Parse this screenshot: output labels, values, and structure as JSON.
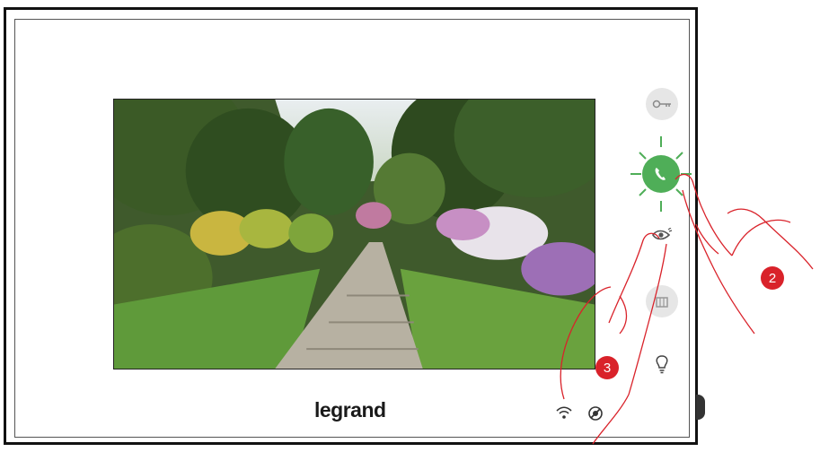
{
  "brand": {
    "logo_text": "legrand"
  },
  "screen": {
    "content": "camera-view-garden"
  },
  "buttons": [
    {
      "id": "door-lock",
      "icon": "key-icon"
    },
    {
      "id": "answer",
      "icon": "phone-icon",
      "state": "blinking",
      "color": "#4fae58"
    },
    {
      "id": "camera-view",
      "icon": "eye-icon"
    },
    {
      "id": "camera-cycle",
      "icon": "camera-cycle-icon"
    },
    {
      "id": "light",
      "icon": "bulb-icon"
    }
  ],
  "status": {
    "wifi_icon": "wifi-icon",
    "mute_icon": "ringer-off-icon"
  },
  "callouts": {
    "step_two": "2",
    "step_three": "3",
    "callout_color": "#d9222a"
  }
}
